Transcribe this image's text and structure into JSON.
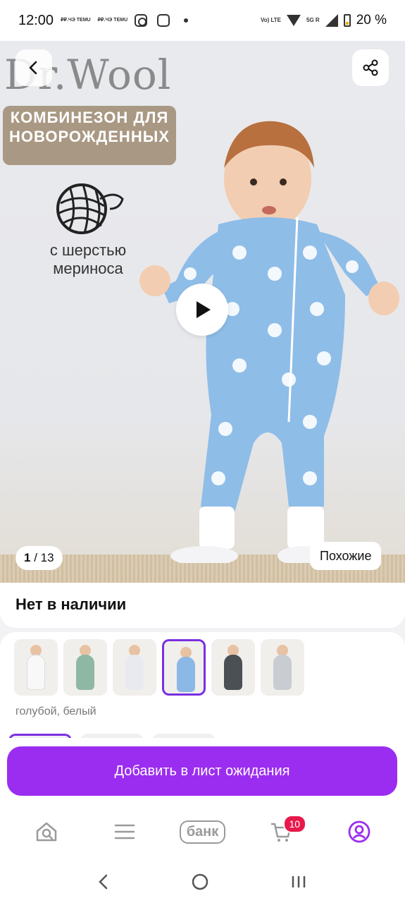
{
  "status_bar": {
    "time": "12:00",
    "mini_icons": [
      "₽₽.ЧЭ TEMU",
      "₽₽.ЧЭ TEMU"
    ],
    "network_label": "Vo) LTE",
    "network_5g": "5G R",
    "battery": "20 %"
  },
  "product": {
    "brand_logo": "Dr.Wool",
    "promo_title": "КОМБИНЕЗОН ДЛЯ НОВОРОЖДЕННЫХ",
    "wool_text": "с шерстью мериноса",
    "image_index": "1",
    "image_total": "/ 13",
    "similar_label": "Похожие",
    "availability": "Нет в наличии",
    "color_name": "голубой, белый",
    "variants": [
      {
        "name": "white",
        "color": "#f4f4f4"
      },
      {
        "name": "green-print",
        "color": "#8fb8a4"
      },
      {
        "name": "white-print",
        "color": "#f0f0f0"
      },
      {
        "name": "blue",
        "color": "#8cb8e6",
        "selected": true
      },
      {
        "name": "dark-print",
        "color": "#4a5054"
      },
      {
        "name": "grey-print",
        "color": "#c9ccd1"
      }
    ]
  },
  "actions": {
    "waitlist_label": "Добавить в лист ожидания"
  },
  "tab_bar": {
    "bank_label": "банк",
    "cart_count": "10"
  },
  "colors": {
    "accent": "#9b2df0",
    "badge": "#e7194b"
  }
}
